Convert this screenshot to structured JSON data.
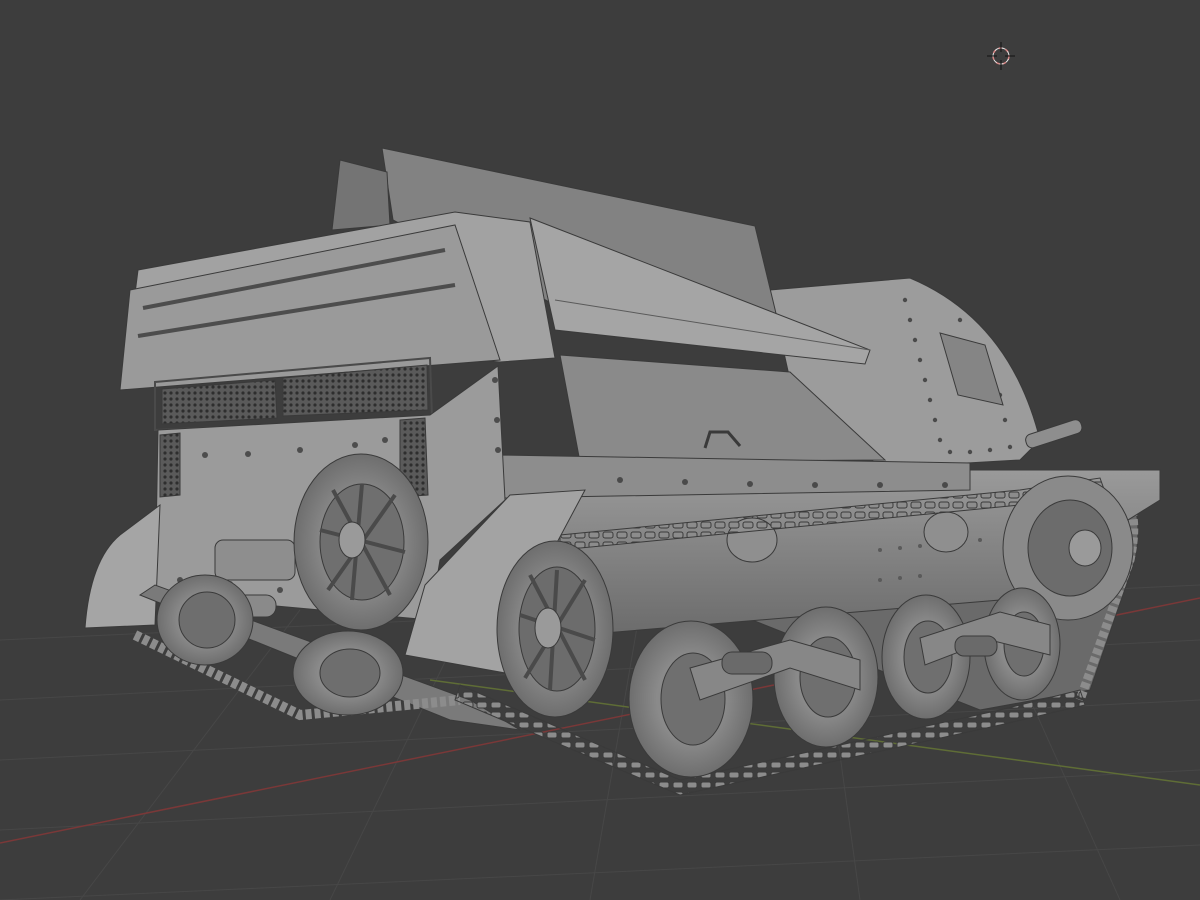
{
  "viewport": {
    "mode": "3d-viewport",
    "shading": "solid-wireframe-overlay",
    "colors": {
      "background": "#3d3d3d",
      "grid_line": "#4a4a4a",
      "x_axis": "#8a3a3a",
      "y_axis": "#6b7a3a",
      "cursor_ring": "#d98686",
      "mesh_light": "#9a9a9a",
      "mesh_mid": "#7e7e7e",
      "mesh_dark": "#5f5f5f",
      "wire": "#3a3a3a"
    }
  },
  "scene": {
    "object": "tracked-armored-vehicle-mesh",
    "icons": {
      "cursor": "3d-cursor-icon"
    }
  }
}
